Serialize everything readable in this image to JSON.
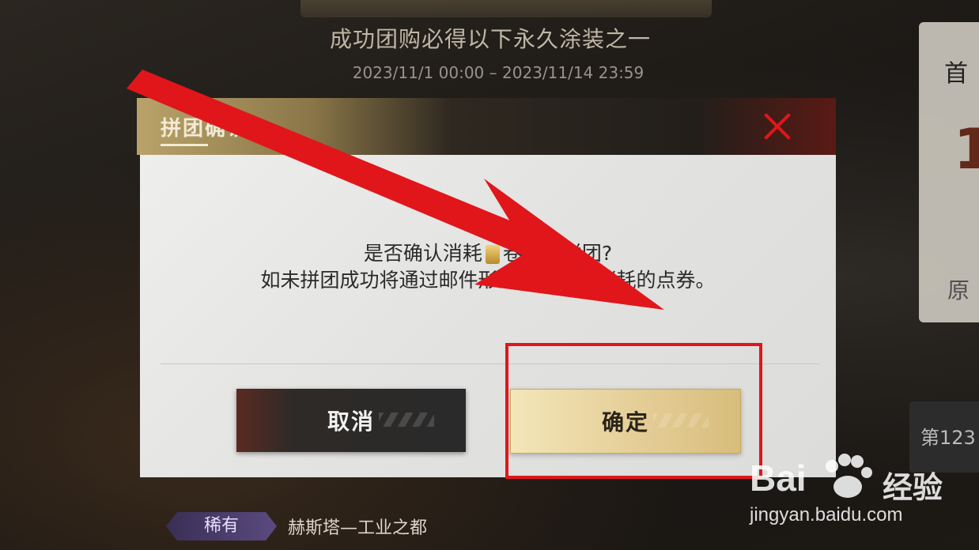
{
  "background": {
    "promo_subtitle": "成功团购必得以下永久涂装之一",
    "promo_dates": "2023/11/1 00:00 – 2023/11/14 23:59",
    "side_card": {
      "label_top": "首",
      "big_digit": "1",
      "label_bottom": "原"
    },
    "side_bar_label": "第123",
    "rarity_label": "稀有",
    "skin_name": "赫斯塔—工业之都"
  },
  "dialog": {
    "title": "拼团确认",
    "message_line1_before": "是否确认消耗",
    "message_line1_after": "卷参与拼团?",
    "message_line2": "如未拼团成功将通过邮件形式返还您所消耗的点券。",
    "cancel_label": "取消",
    "confirm_label": "确定",
    "accent_color": "#e0161b"
  },
  "watermark": {
    "brand": "Bai",
    "word": "经验",
    "url": "jingyan.baidu.com"
  }
}
